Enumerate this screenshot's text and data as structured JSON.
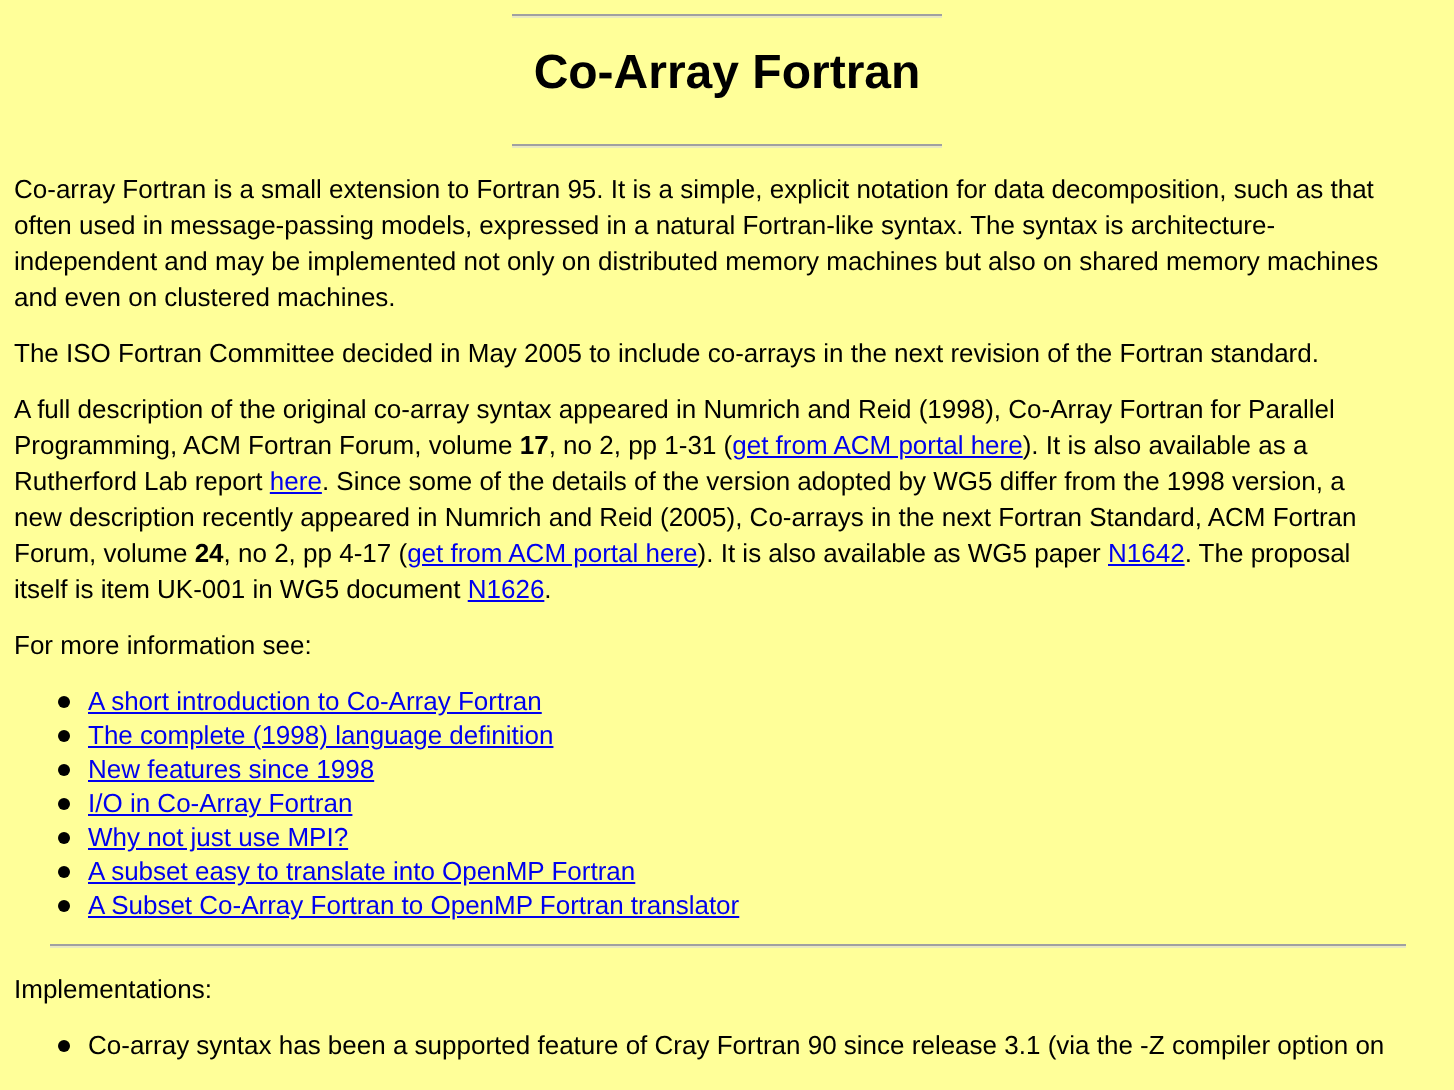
{
  "title": "Co-Array Fortran",
  "paragraphs": [
    [
      {
        "kind": "text",
        "text": "Co-array Fortran is a small extension to Fortran 95. It is a simple, explicit notation for data decomposition, such as that often used in message-passing models, expressed in a natural Fortran-like syntax. The syntax is architecture-independent and may be implemented not only on distributed memory machines but also on shared memory machines and even on clustered machines."
      }
    ],
    [
      {
        "kind": "text",
        "text": "The ISO Fortran Committee decided in May 2005 to include co-arrays in the next revision of the Fortran standard."
      }
    ],
    [
      {
        "kind": "text",
        "text": "A full description of the original co-array syntax appeared in Numrich and Reid (1998), Co-Array Fortran for Parallel Programming, ACM Fortran Forum, volume **17**, no 2, pp 1-31 ("
      },
      {
        "kind": "link",
        "text": "get from ACM portal here"
      },
      {
        "kind": "text",
        "text": "). It is also available as a Rutherford Lab report "
      },
      {
        "kind": "link",
        "text": "here"
      },
      {
        "kind": "text",
        "text": ". Since some of the details of the version adopted by WG5 differ from the 1998 version, a new description recently appeared in Numrich and Reid (2005), Co-arrays in the next Fortran Standard, ACM Fortran Forum, volume **24**, no 2, pp 4-17 ("
      },
      {
        "kind": "link",
        "text": "get from ACM portal here"
      },
      {
        "kind": "text",
        "text": "). It is also available as WG5 paper "
      },
      {
        "kind": "link",
        "text": "N1642"
      },
      {
        "kind": "text",
        "text": ". The proposal itself is item UK-001 in WG5 document "
      },
      {
        "kind": "link",
        "text": "N1626"
      },
      {
        "kind": "text",
        "text": "."
      }
    ],
    [
      {
        "kind": "text",
        "text": "For more information see:"
      }
    ]
  ],
  "links": [
    "A short introduction to Co-Array Fortran",
    "The complete (1998) language definition",
    "New features since 1998",
    "I/O in Co-Array Fortran",
    "Why not just use MPI?",
    "A subset easy to translate into OpenMP Fortran",
    "A Subset Co-Array Fortran to OpenMP Fortran translator"
  ],
  "implementations_heading": "Implementations:",
  "implementations": [
    "Co-array syntax has been a supported feature of Cray Fortran 90 since release 3.1 (via the -Z compiler option on"
  ]
}
